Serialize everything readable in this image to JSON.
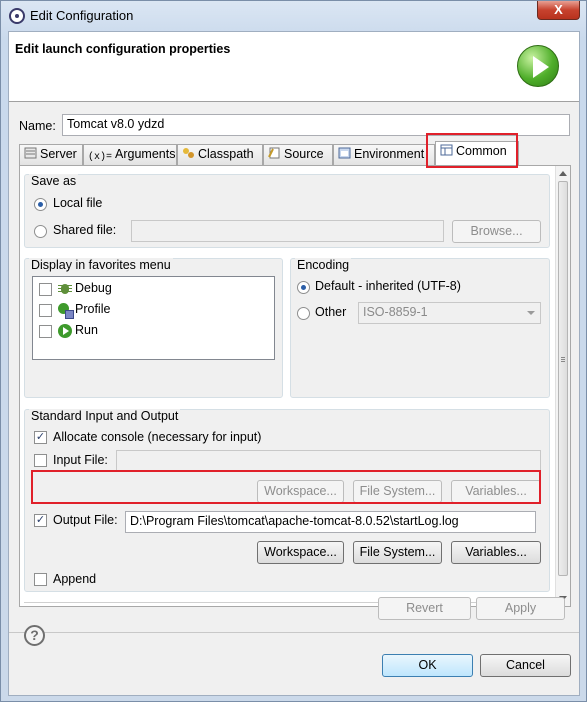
{
  "window": {
    "title": "Edit Configuration",
    "close_label": "X"
  },
  "header": {
    "title": "Edit launch configuration properties"
  },
  "name": {
    "label": "Name:",
    "value": "Tomcat v8.0 ydzd"
  },
  "tabs": [
    {
      "label": "Server",
      "icon": "server-icon"
    },
    {
      "label": "Arguments",
      "icon": "arguments-icon"
    },
    {
      "label": "Classpath",
      "icon": "classpath-icon"
    },
    {
      "label": "Source",
      "icon": "source-icon"
    },
    {
      "label": "Environment",
      "icon": "environment-icon"
    },
    {
      "label": "Common",
      "icon": "common-icon",
      "active": true
    }
  ],
  "save_as": {
    "title": "Save as",
    "local_file_label": "Local file",
    "shared_file_label": "Shared file:",
    "shared_file_value": "",
    "browse_label": "Browse..."
  },
  "favorites": {
    "title": "Display in favorites menu",
    "items": [
      {
        "label": "Debug",
        "icon": "debug-icon",
        "checked": false
      },
      {
        "label": "Profile",
        "icon": "profile-icon",
        "checked": false
      },
      {
        "label": "Run",
        "icon": "run-icon",
        "checked": false
      }
    ]
  },
  "encoding": {
    "title": "Encoding",
    "default_label": "Default - inherited (UTF-8)",
    "other_label": "Other",
    "other_value": "ISO-8859-1"
  },
  "std_io": {
    "title": "Standard Input and Output",
    "allocate_console_label": "Allocate console (necessary for input)",
    "input_file_label": "Input File:",
    "input_file_value": "",
    "workspace_label": "Workspace...",
    "file_system_label": "File System...",
    "variables_label": "Variables...",
    "output_file_label": "Output File:",
    "output_file_value": "D:\\Program Files\\tomcat\\apache-tomcat-8.0.52\\startLog.log",
    "append_label": "Append"
  },
  "actions": {
    "revert_label": "Revert",
    "apply_label": "Apply",
    "ok_label": "OK",
    "cancel_label": "Cancel",
    "help_label": "?"
  },
  "check_mark": "✓"
}
